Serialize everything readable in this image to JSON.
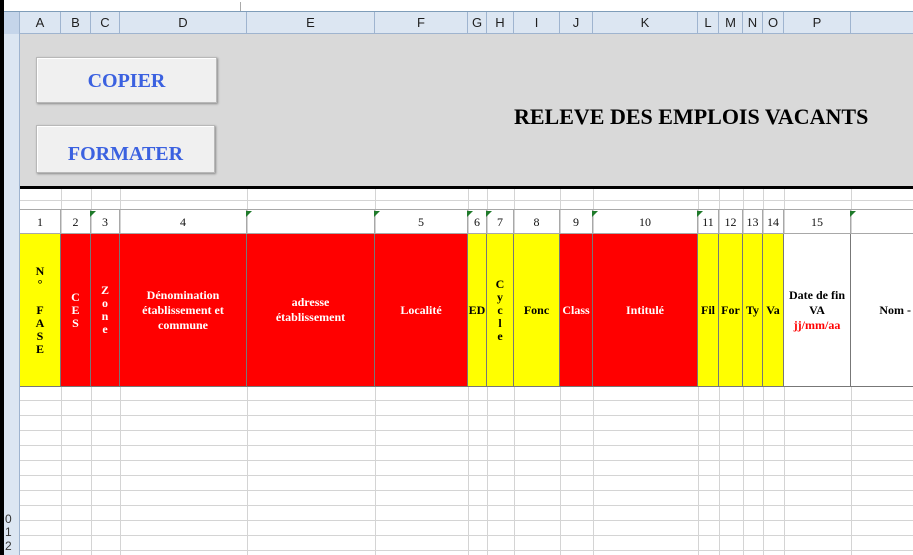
{
  "columns": [
    "A",
    "B",
    "C",
    "D",
    "E",
    "F",
    "G",
    "H",
    "I",
    "J",
    "K",
    "L",
    "M",
    "N",
    "O",
    "P"
  ],
  "rows": [
    "0",
    "1",
    "2"
  ],
  "buttons": {
    "copy": "COPIER",
    "format": "FORMATER"
  },
  "title": "RELEVE DES EMPLOIS VACANTS",
  "col_numbers": [
    "1",
    "2",
    "3",
    "4",
    "5",
    "6",
    "7",
    "8",
    "9",
    "10",
    "11",
    "12",
    "13",
    "14",
    "15"
  ],
  "headers": {
    "fase": "N\n°\n\nF\nA\nS\nE",
    "ces": "C\nE\nS",
    "zone": "Z\no\nn\ne",
    "denomination": "Dénomination établissement et commune",
    "adresse": "adresse établissement",
    "localite": "Localité",
    "ed": "ED",
    "cycle": "C\ny\nc\nl\ne",
    "fonc": "Fonc",
    "class": "Class",
    "intitule": "Intitulé",
    "fil": "Fil",
    "for": "For",
    "ty": "Ty",
    "va": "Va",
    "date": "Date de fin VA",
    "date_format": "jj/mm/aa",
    "nom": "Nom -"
  },
  "colors": {
    "red": "#ff0000",
    "yellow": "#ffff00",
    "button_text": "#3b61e0",
    "panel": "#d9d9d9"
  }
}
